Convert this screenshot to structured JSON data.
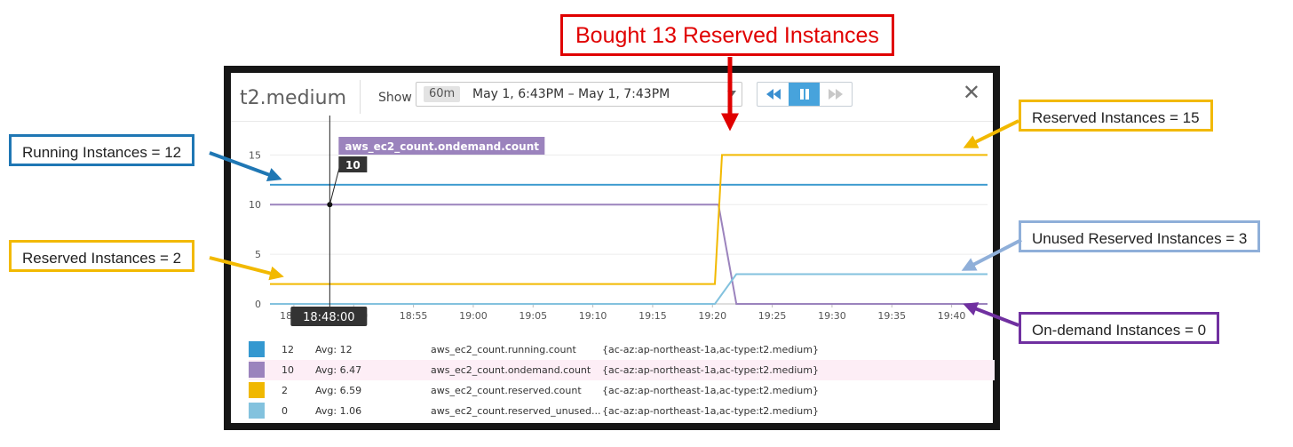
{
  "panel": {
    "title": "t2.medium",
    "show_label": "Show",
    "span_badge": "60m",
    "time_range": "May 1, 6:43PM – May 1, 7:43PM",
    "close_icon": "close-icon"
  },
  "controls": {
    "rewind_icon": "rewind-icon",
    "pause_icon": "pause-icon",
    "forward_icon": "fast-forward-icon"
  },
  "tooltip": {
    "metric": "aws_ec2_count.ondemand.count",
    "value": "10",
    "time": "18:48:00"
  },
  "chart_data": {
    "type": "line",
    "x_ticks": [
      "18:45",
      "18:50",
      "18:55",
      "19:00",
      "19:05",
      "19:10",
      "19:15",
      "19:20",
      "19:25",
      "19:30",
      "19:35",
      "19:40"
    ],
    "y_ticks": [
      "0",
      "5",
      "10",
      "15"
    ],
    "ylim": [
      0,
      17
    ],
    "x_domain_minutes": [
      43,
      103
    ],
    "grid": true,
    "series": [
      {
        "name": "aws_ec2_count.running.count",
        "color": "#3f9bd0",
        "points": [
          [
            43,
            12
          ],
          [
            103,
            12
          ]
        ]
      },
      {
        "name": "aws_ec2_count.ondemand.count",
        "color": "#9b83bd",
        "points": [
          [
            43,
            10
          ],
          [
            80.5,
            10
          ],
          [
            82,
            0
          ],
          [
            103,
            0
          ]
        ]
      },
      {
        "name": "aws_ec2_count.reserved.count",
        "color": "#f2b900",
        "points": [
          [
            43,
            2
          ],
          [
            80.2,
            2
          ],
          [
            80.8,
            15
          ],
          [
            103,
            15
          ]
        ]
      },
      {
        "name": "aws_ec2_count.reserved_unused.count",
        "color": "#83c2de",
        "points": [
          [
            43,
            0
          ],
          [
            80.2,
            0
          ],
          [
            82,
            3
          ],
          [
            103,
            3
          ]
        ]
      }
    ]
  },
  "legend": [
    {
      "color": "#3498d0",
      "value": "12",
      "avg": "Avg: 12",
      "metric": "aws_ec2_count.running.count",
      "tags": "{ac-az:ap-northeast-1a,ac-type:t2.medium}"
    },
    {
      "color": "#9b83bd",
      "value": "10",
      "avg": "Avg: 6.47",
      "metric": "aws_ec2_count.ondemand.count",
      "tags": "{ac-az:ap-northeast-1a,ac-type:t2.medium}"
    },
    {
      "color": "#f0b800",
      "value": "2",
      "avg": "Avg: 6.59",
      "metric": "aws_ec2_count.reserved.count",
      "tags": "{ac-az:ap-northeast-1a,ac-type:t2.medium}"
    },
    {
      "color": "#83c2de",
      "value": "0",
      "avg": "Avg: 1.06",
      "metric": "aws_ec2_count.reserved_unused...",
      "tags": "{ac-az:ap-northeast-1a,ac-type:t2.medium}"
    }
  ],
  "annotations": {
    "bought": "Bought 13 Reserved Instances",
    "running": "Running Instances = 12",
    "reserved_2": "Reserved Instances = 2",
    "reserved_15": "Reserved Instances = 15",
    "unused": "Unused Reserved Instances = 3",
    "ondemand": "On-demand Instances = 0",
    "colors": {
      "blue": "#1f77b4",
      "yellow": "#f2b900",
      "light_blue": "#8fafd9",
      "purple": "#7030a0",
      "red": "#e00000"
    }
  }
}
